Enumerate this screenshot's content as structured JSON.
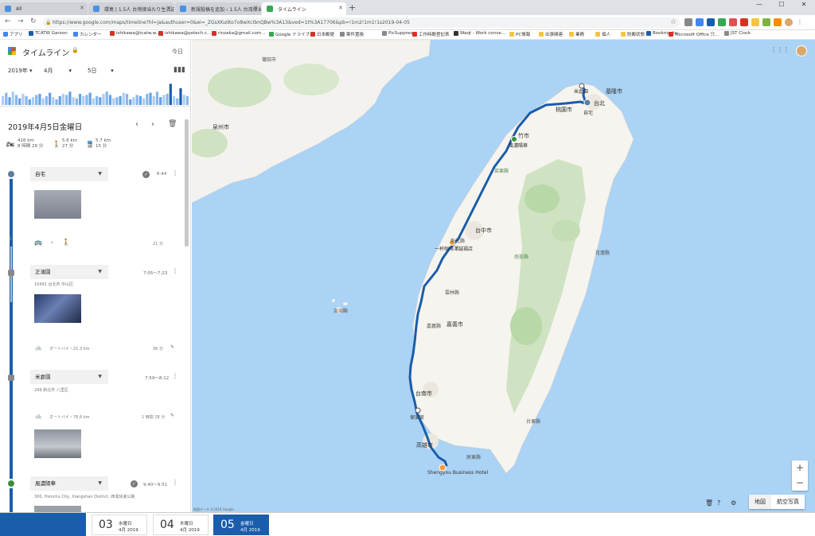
{
  "tabs": [
    {
      "label": "All",
      "active": false
    },
    {
      "label": "環島 | 1.5人 台灣律当たり生活記",
      "active": false
    },
    {
      "label": "新規投稿を追加 ‹ 1.5人 台湾律当た",
      "active": false
    },
    {
      "label": "タイムライン",
      "active": true
    }
  ],
  "window": {
    "minimize": "—",
    "maximize": "☐",
    "close": "✕"
  },
  "address": {
    "url": "https://www.google.com/maps/timeline?hl=ja&authuser=0&ei=_ZGsXKutKo7o8wXcIbnQBw%3A13&ved=1t%3A17706&pb=!1m2!1m1!1s2019-04-05",
    "lock": "🔒",
    "star": "☆"
  },
  "bookmarks": [
    {
      "label": "アプリ",
      "color": "#4285f4"
    },
    {
      "label": "TCATW Garoon",
      "color": "#1a5dab"
    },
    {
      "label": "カレンダー",
      "color": "#4285f4"
    },
    {
      "label": "ishikawa@tcatw.w...",
      "color": "#d93025"
    },
    {
      "label": "ishikawa@potech.c...",
      "color": "#d93025"
    },
    {
      "label": "rinzaka@gmail.com...",
      "color": "#d93025"
    },
    {
      "label": "Google ドライブ",
      "color": "#34a853"
    },
    {
      "label": "日本郵便",
      "color": "#d93025"
    },
    {
      "label": "案件置換",
      "color": "#888888"
    },
    {
      "label": "PicSuppress",
      "color": "#888888"
    },
    {
      "label": "工作時数登記表",
      "color": "#d93025"
    },
    {
      "label": "Waqt - Work conve...",
      "color": "#333333"
    },
    {
      "label": "PC情報",
      "color": "#f4c542"
    },
    {
      "label": "出張関連",
      "color": "#f4c542"
    },
    {
      "label": "業務",
      "color": "#f4c542"
    },
    {
      "label": "個人",
      "color": "#f4c542"
    },
    {
      "label": "防郵状態",
      "color": "#f4c542"
    },
    {
      "label": "Bookmarks",
      "color": "#1a5dab"
    },
    {
      "label": "Microsoft Office 只...",
      "color": "#d93025"
    },
    {
      "label": "JST Clock",
      "color": "#888888"
    }
  ],
  "panel": {
    "title": "タイムライン",
    "today": "今日",
    "year": "2019年",
    "month": "4月",
    "day": "5日",
    "date_heading": "2019年4月5日金曜日",
    "summary": {
      "moto_km": "416 km",
      "moto_time": "8 時間 29 分",
      "walk_km": "5.6 km",
      "walk_time": "27 分",
      "transit_km": "5.7 km",
      "transit_time": "15 分"
    },
    "entries": {
      "home": {
        "place": "自宅",
        "time": "6:44"
      },
      "transit1": {
        "time": "21 分"
      },
      "place2": {
        "place": "正濱園",
        "time": "7:05〜7:23",
        "address": "10491 台北市 中山区"
      },
      "moto1": {
        "label": "オートバイ・21.3 km",
        "time": "36 分"
      },
      "place3": {
        "place": "米倉園",
        "time": "7:59〜8:12",
        "address": "249 新北市 八里区"
      },
      "moto2": {
        "label": "オートバイ・76.6 km",
        "time": "1 時間 28 分"
      },
      "place4": {
        "place": "風濃陽華",
        "time": "9:40〜9:51",
        "address": "300, Hsinchu City, Xiangshan District, 西濱快速公路"
      }
    }
  },
  "histogram": {
    "values": [
      0.4,
      0.55,
      0.35,
      0.6,
      0.45,
      0.3,
      0.5,
      0.4,
      0.25,
      0.35,
      0.45,
      0.5,
      0.3,
      0.4,
      0.55,
      0.35,
      0.25,
      0.4,
      0.5,
      0.45,
      0.6,
      0.35,
      0.3,
      0.5,
      0.4,
      0.45,
      0.55,
      0.3,
      0.4,
      0.35,
      0.5,
      0.6,
      0.45,
      0.3,
      0.35,
      0.4,
      0.55,
      0.5,
      0.25,
      0.35,
      0.45,
      0.4,
      0.3,
      0.5,
      0.55,
      0.4,
      0.6,
      0.35,
      0.45,
      0.5,
      0.95,
      0.4,
      0.3,
      0.75,
      0.45,
      0.4
    ],
    "highlight": [
      0.95,
      0.75
    ],
    "bar_color": "#4a90e2",
    "dark_color": "#1a5dab"
  },
  "map": {
    "labels": {
      "taipei": "台北",
      "taoyuan": "桃園市",
      "keelung": "基隆市",
      "hsinchu": "竹市",
      "taichung": "台中市",
      "hualien": "花蓮縣",
      "chiayi": "嘉義市",
      "tainan": "台南市",
      "kaohsiung": "高雄市",
      "pingtung": "屏東縣",
      "quanzhou": "泉州市",
      "putian": "莆田市",
      "changhua": "彰化縣",
      "yunlin": "雲林縣",
      "nantou": "南投縣",
      "chiayi_county": "嘉義縣",
      "taitung": "台東縣",
      "penghu": "澎湖縣",
      "miaoli": "苗栗縣",
      "hotel": "Shengyou Business Hotel",
      "stop1": "米倉園",
      "stop2": "風濃陽華",
      "stop3": "一杯咖啡澤誠福店",
      "stop4": "保安宮",
      "home": "自宅"
    },
    "copyright": "地図データ ©2019 Google",
    "zoom_in": "+",
    "zoom_out": "−",
    "type_map": "地図",
    "type_sat": "航空写真"
  },
  "bottom": {
    "days": [
      {
        "num": "03",
        "weekday": "水曜日",
        "month": "4月 2019",
        "active": false
      },
      {
        "num": "04",
        "weekday": "木曜日",
        "month": "4月 2019",
        "active": false
      },
      {
        "num": "05",
        "weekday": "金曜日",
        "month": "4月 2019",
        "active": true
      }
    ]
  }
}
